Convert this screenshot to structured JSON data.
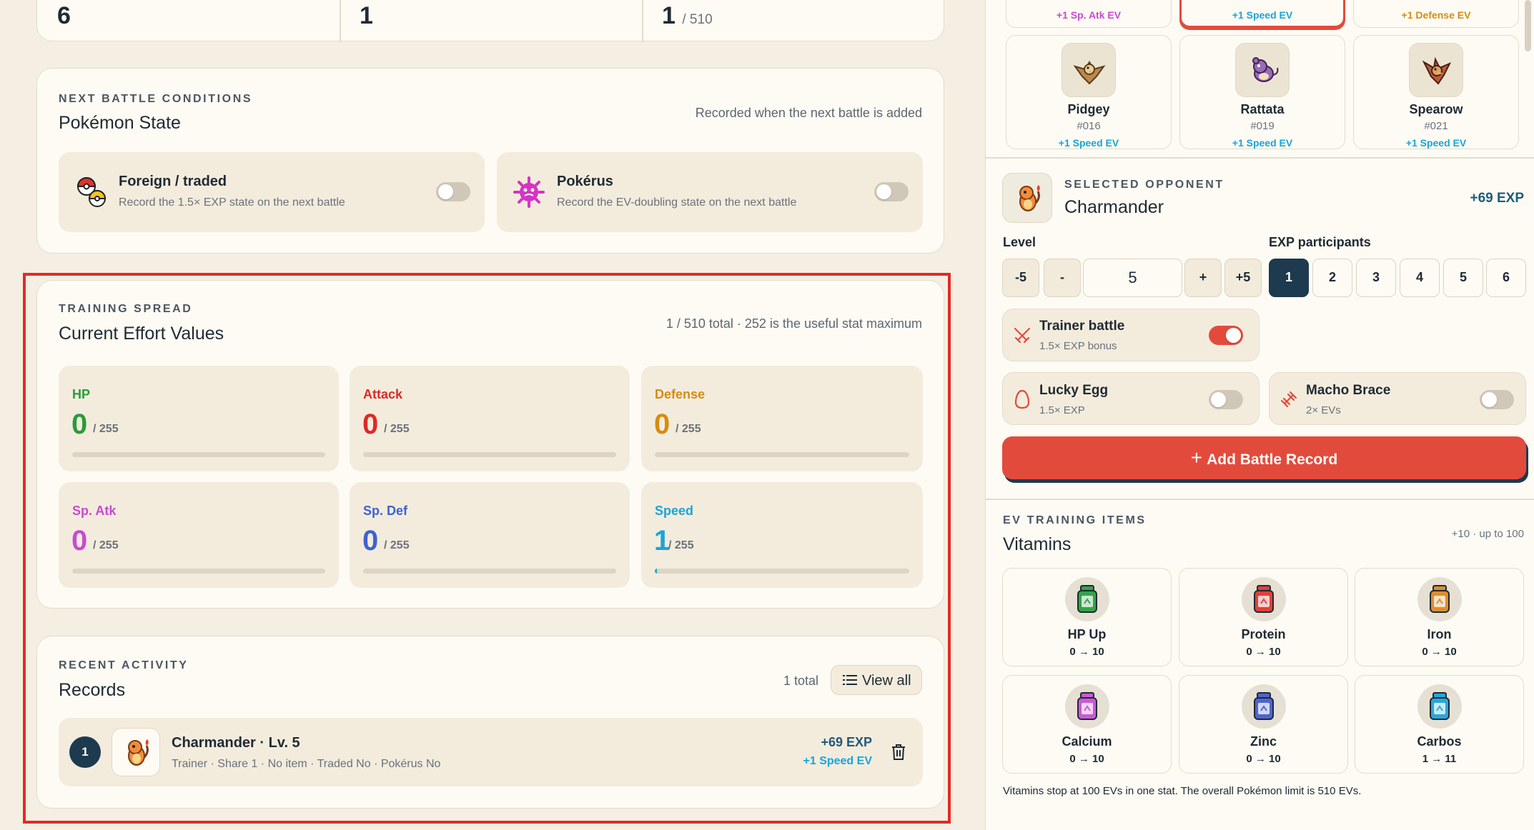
{
  "summary": {
    "cells": [
      {
        "value": "6",
        "suffix": ""
      },
      {
        "value": "1",
        "suffix": ""
      },
      {
        "value": "1",
        "suffix": "/ 510"
      }
    ]
  },
  "conditions": {
    "eyebrow": "NEXT BATTLE CONDITIONS",
    "title": "Pokémon State",
    "note": "Recorded when the next battle is added",
    "options": [
      {
        "label": "Foreign / traded",
        "desc": "Record the 1.5× EXP state on the next battle",
        "on": false
      },
      {
        "label": "Pokérus",
        "desc": "Record the EV-doubling state on the next battle",
        "on": false
      }
    ]
  },
  "spread": {
    "eyebrow": "TRAINING SPREAD",
    "title": "Current Effort Values",
    "note": "1 / 510 total · 252 is the useful stat maximum",
    "max_label": "/ 255",
    "stats": [
      {
        "label": "HP",
        "value": "0",
        "fill": 0,
        "color": "#2a9c3b"
      },
      {
        "label": "Attack",
        "value": "0",
        "fill": 0,
        "color": "#dd2a27"
      },
      {
        "label": "Defense",
        "value": "0",
        "fill": 0,
        "color": "#d58d12"
      },
      {
        "label": "Sp. Atk",
        "value": "0",
        "fill": 0,
        "color": "#c94ad2"
      },
      {
        "label": "Sp. Def",
        "value": "0",
        "fill": 0,
        "color": "#3e62cf"
      },
      {
        "label": "Speed",
        "value": "1",
        "fill": 0.004,
        "color": "#1aa5d6"
      }
    ]
  },
  "records": {
    "eyebrow": "RECENT ACTIVITY",
    "title": "Records",
    "count": "1 total",
    "view_all": "View all",
    "items": [
      {
        "index": "1",
        "name": "Charmander · Lv. 5",
        "detail": "Trainer · Share 1 · No item · Traded No · Pokérus No",
        "exp": "+69 EXP",
        "ev": "+1 Speed EV"
      }
    ]
  },
  "opponents": {
    "top_row": [
      {
        "ev": "+1 Sp. Atk EV",
        "color": "#c94ad2"
      },
      {
        "ev": "+1 Speed EV",
        "color": "#1aa5d6"
      },
      {
        "ev": "+1 Defense EV",
        "color": "#d58d12"
      }
    ],
    "grid": [
      {
        "name": "Pidgey",
        "num": "#016",
        "ev": "+1 Speed EV"
      },
      {
        "name": "Rattata",
        "num": "#019",
        "ev": "+1 Speed EV"
      },
      {
        "name": "Spearow",
        "num": "#021",
        "ev": "+1 Speed EV"
      }
    ]
  },
  "selected": {
    "eyebrow": "SELECTED OPPONENT",
    "name": "Charmander",
    "exp": "+69 EXP",
    "level_label": "Level",
    "level_value": "5",
    "level_buttons": [
      "-5",
      "-",
      "+",
      "+5"
    ],
    "participants_label": "EXP participants",
    "participants": [
      "1",
      "2",
      "3",
      "4",
      "5",
      "6"
    ],
    "trainer": {
      "label": "Trainer battle",
      "desc": "1.5× EXP bonus",
      "on": true
    },
    "lucky_egg": {
      "label": "Lucky Egg",
      "desc": "1.5× EXP",
      "on": false
    },
    "macho_brace": {
      "label": "Macho Brace",
      "desc": "2× EVs",
      "on": false
    },
    "add_button": "Add Battle Record"
  },
  "vitamins": {
    "eyebrow": "EV TRAINING ITEMS",
    "title": "Vitamins",
    "note": "+10 · up to 100",
    "items": [
      {
        "name": "HP Up",
        "range": "0 → 10",
        "color": "#33a447"
      },
      {
        "name": "Protein",
        "range": "0 → 10",
        "color": "#e0413a"
      },
      {
        "name": "Iron",
        "range": "0 → 10",
        "color": "#e08d2a"
      },
      {
        "name": "Calcium",
        "range": "0 → 10",
        "color": "#c95ad5"
      },
      {
        "name": "Zinc",
        "range": "0 → 10",
        "color": "#4f64cf"
      },
      {
        "name": "Carbos",
        "range": "1 → 11",
        "color": "#2aa6db"
      }
    ],
    "footer": "Vitamins stop at 100 EVs in one stat. The overall Pokémon limit is 510 EVs."
  }
}
